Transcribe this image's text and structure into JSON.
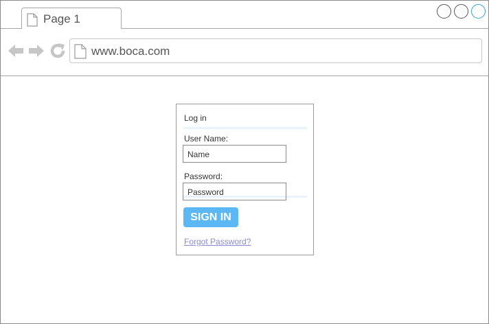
{
  "browser": {
    "tab_title": "Page 1",
    "url": "www.boca.com"
  },
  "icons": {
    "tab": "document-icon",
    "address": "document-icon",
    "back": "back-arrow-icon",
    "forward": "forward-arrow-icon",
    "refresh": "refresh-icon"
  },
  "login": {
    "title": "Log in",
    "username_label": "User Name:",
    "username_value": "Name",
    "password_label": "Password:",
    "password_value": "Password",
    "signin_label": "SIGN IN",
    "forgot_link": "Forgot Password?"
  },
  "colors": {
    "accent": "#5bb8f5",
    "link": "#8a8ad8",
    "window_control_active": "#3aa0d8"
  }
}
